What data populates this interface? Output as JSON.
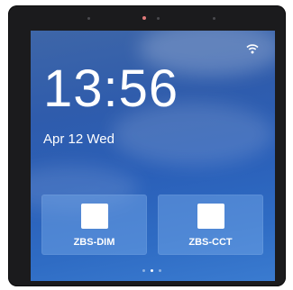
{
  "status_bar": {
    "wifi_icon": "wifi-icon"
  },
  "clock": {
    "time": "13:56",
    "date": "Apr 12 Wed"
  },
  "tiles": [
    {
      "label": "ZBS-DIM",
      "icon": "device-square-icon"
    },
    {
      "label": "ZBS-CCT",
      "icon": "device-square-icon"
    }
  ],
  "pager": {
    "page_count": 3,
    "current_page": 2
  },
  "colors": {
    "screen_bg": "#2f5cac",
    "tile_bg": "#78aaeb",
    "text": "#ffffff",
    "bezel": "#1b1b1d"
  }
}
